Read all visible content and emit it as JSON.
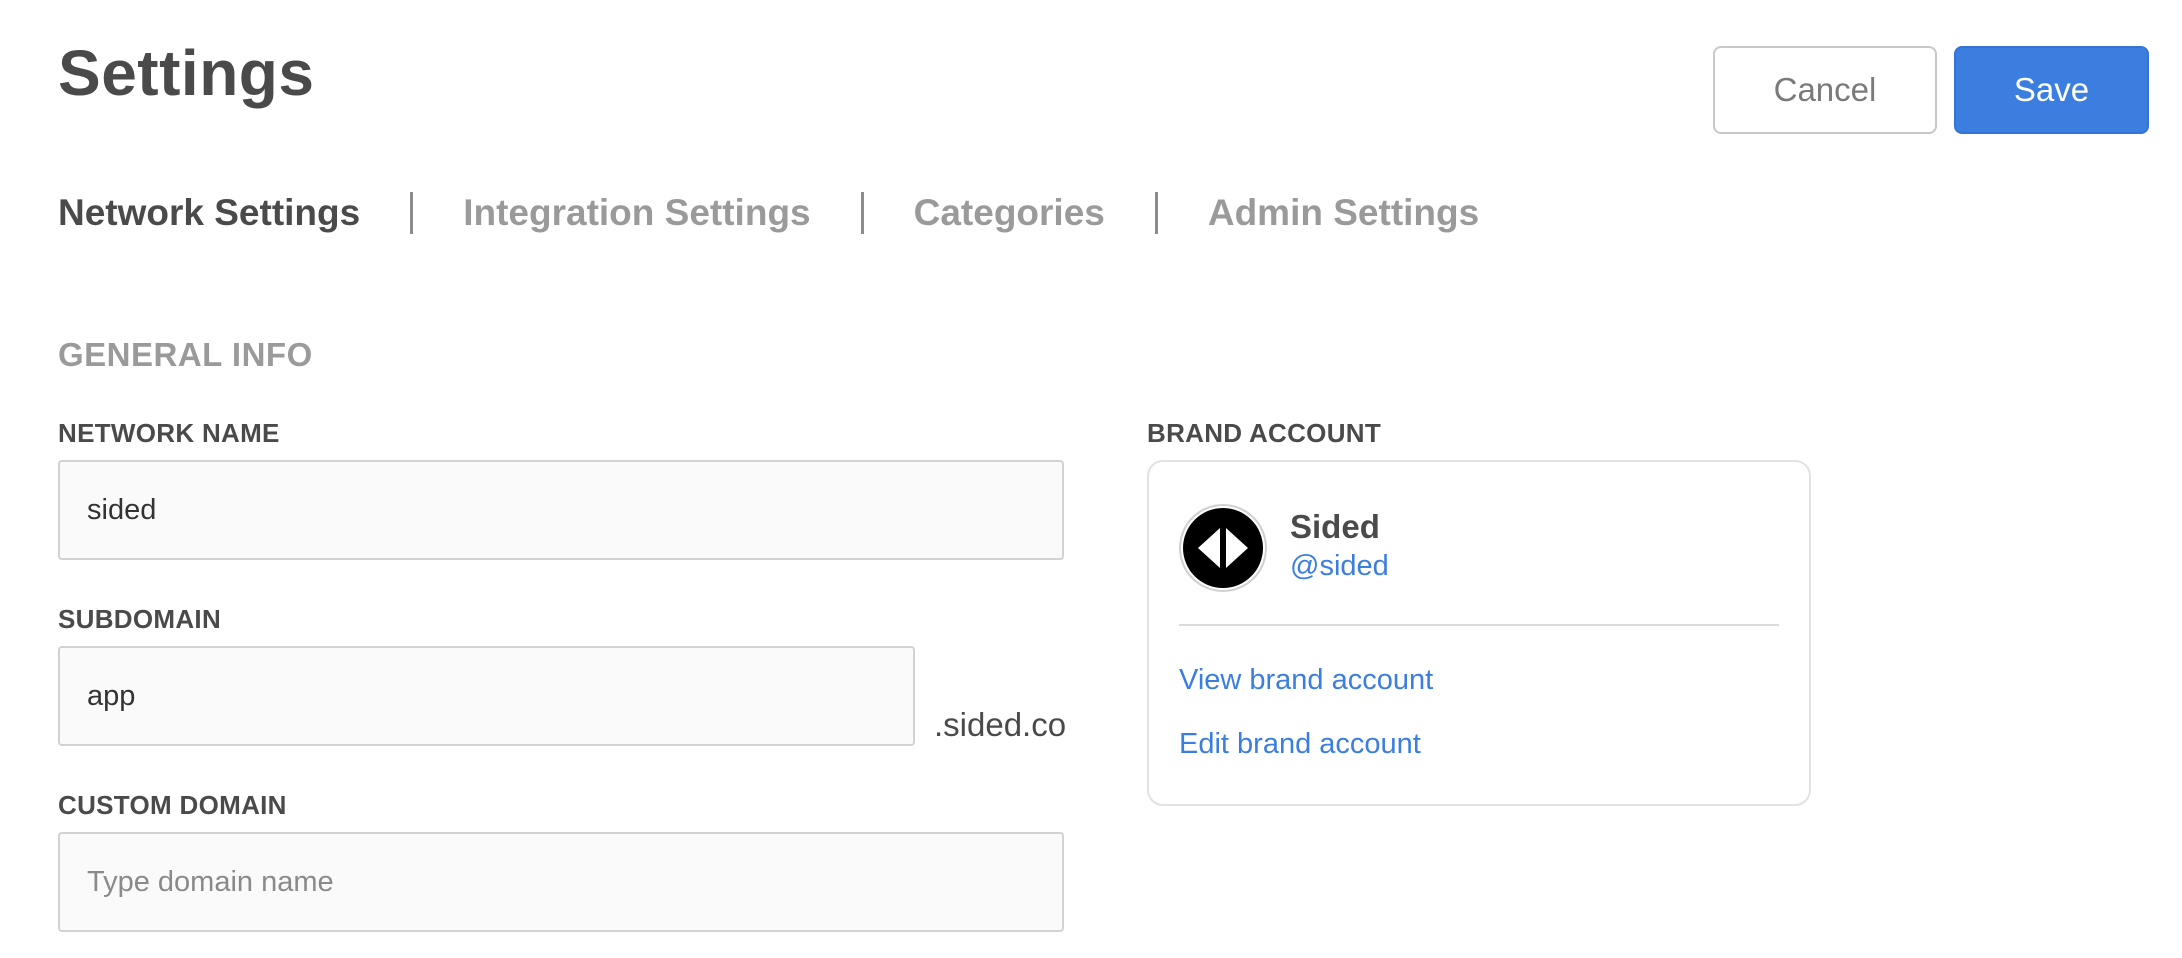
{
  "page": {
    "title": "Settings"
  },
  "actions": {
    "cancel_label": "Cancel",
    "save_label": "Save"
  },
  "tabs": [
    {
      "label": "Network Settings",
      "active": true
    },
    {
      "label": "Integration Settings",
      "active": false
    },
    {
      "label": "Categories",
      "active": false
    },
    {
      "label": "Admin Settings",
      "active": false
    }
  ],
  "general_info": {
    "title": "GENERAL INFO",
    "network_name": {
      "label": "NETWORK NAME",
      "value": "sided"
    },
    "subdomain": {
      "label": "SUBDOMAIN",
      "value": "app",
      "suffix": ".sided.co"
    },
    "custom_domain": {
      "label": "CUSTOM DOMAIN",
      "value": "",
      "placeholder": "Type domain name"
    }
  },
  "brand_account": {
    "label": "BRAND ACCOUNT",
    "avatar_icon": "sided-logo-icon",
    "name": "Sided",
    "handle": "@sided",
    "view_link": "View brand account",
    "edit_link": "Edit brand account"
  },
  "colors": {
    "accent": "#3b7ee0",
    "text": "#4a4a4a",
    "muted": "#9a9a9a"
  }
}
